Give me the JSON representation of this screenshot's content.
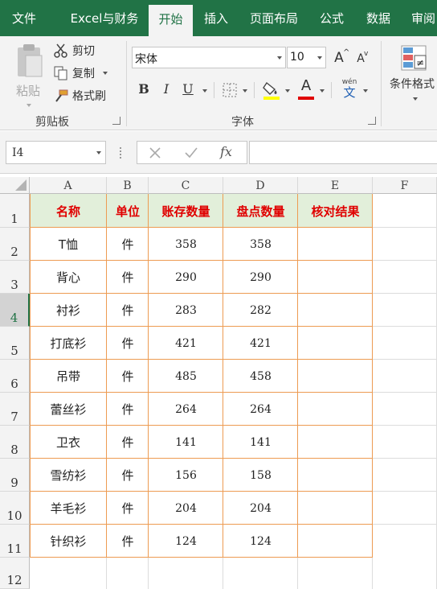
{
  "tabs": [
    {
      "label": "文件",
      "active": false
    },
    {
      "label": "Excel与财务",
      "active": false
    },
    {
      "label": "开始",
      "active": true
    },
    {
      "label": "插入",
      "active": false
    },
    {
      "label": "页面布局",
      "active": false
    },
    {
      "label": "公式",
      "active": false
    },
    {
      "label": "数据",
      "active": false
    },
    {
      "label": "审阅",
      "active": false
    }
  ],
  "clipboard": {
    "paste_label": "粘贴",
    "cut_label": "剪切",
    "copy_label": "复制",
    "format_painter_label": "格式刷",
    "group_label": "剪贴板"
  },
  "font": {
    "font_name": "宋体",
    "font_size": "10",
    "grow_label": "A",
    "shrink_label": "A",
    "bold_label": "B",
    "italic_label": "I",
    "underline_label": "U",
    "font_color_label": "A",
    "phonetic_top": "wén",
    "phonetic_bottom": "文",
    "group_label": "字体",
    "fill_color": "#ffff00",
    "font_color": "#e00000"
  },
  "styles": {
    "conditional_label": "条件格式"
  },
  "formula_bar": {
    "name_box": "I4",
    "fx_label": "fx",
    "formula": ""
  },
  "columns": [
    "A",
    "B",
    "C",
    "D",
    "E",
    "F"
  ],
  "header_row": [
    "名称",
    "单位",
    "账存数量",
    "盘点数量",
    "核对结果"
  ],
  "rows": [
    {
      "row": "1"
    },
    {
      "row": "2",
      "name": "T恤",
      "unit": "件",
      "book": "358",
      "count": "358"
    },
    {
      "row": "3",
      "name": "背心",
      "unit": "件",
      "book": "290",
      "count": "290"
    },
    {
      "row": "4",
      "name": "衬衫",
      "unit": "件",
      "book": "283",
      "count": "282"
    },
    {
      "row": "5",
      "name": "打底衫",
      "unit": "件",
      "book": "421",
      "count": "421"
    },
    {
      "row": "6",
      "name": "吊带",
      "unit": "件",
      "book": "485",
      "count": "458"
    },
    {
      "row": "7",
      "name": "蕾丝衫",
      "unit": "件",
      "book": "264",
      "count": "264"
    },
    {
      "row": "8",
      "name": "卫衣",
      "unit": "件",
      "book": "141",
      "count": "141"
    },
    {
      "row": "9",
      "name": "雪纺衫",
      "unit": "件",
      "book": "156",
      "count": "158"
    },
    {
      "row": "10",
      "name": "羊毛衫",
      "unit": "件",
      "book": "204",
      "count": "204"
    },
    {
      "row": "11",
      "name": "针织衫",
      "unit": "件",
      "book": "124",
      "count": "124"
    },
    {
      "row": "12"
    }
  ],
  "colors": {
    "ribbon_green": "#217346",
    "header_fill": "#e2efda",
    "header_text": "#e00000",
    "border_orange": "#ed9b52"
  }
}
